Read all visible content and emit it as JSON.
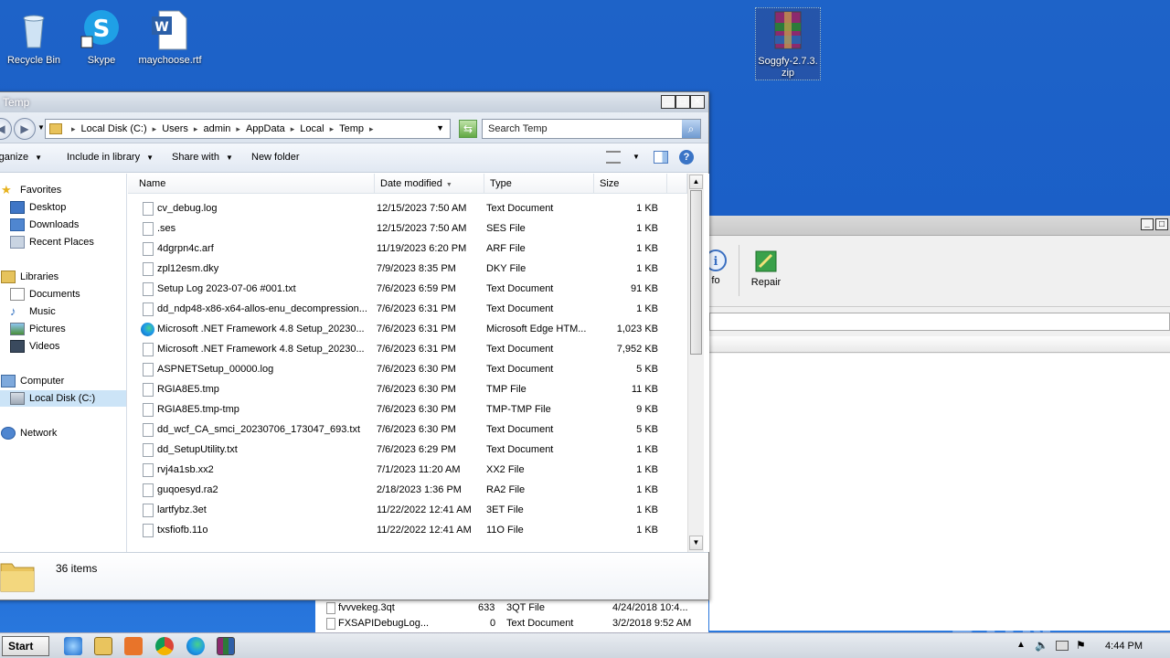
{
  "desktop": {
    "icons": [
      {
        "label": "Recycle Bin"
      },
      {
        "label": "Skype"
      },
      {
        "label": "maychoose.rtf"
      },
      {
        "label": "Soggfy-2.7.3.\nzip"
      }
    ]
  },
  "background_app": {
    "toolbar": {
      "info_label": "fo",
      "repair_label": "Repair"
    },
    "rows": [
      {
        "name": "fvvvekeg.3qt",
        "size": "633",
        "type": "3QT File",
        "modified": "4/24/2018 10:4..."
      },
      {
        "name": "FXSAPIDebugLog...",
        "size": "0",
        "type": "Text Document",
        "modified": "3/2/2018 9:52 AM"
      }
    ]
  },
  "explorer": {
    "title": "Temp",
    "address": [
      "Local Disk (C:)",
      "Users",
      "admin",
      "AppData",
      "Local",
      "Temp"
    ],
    "search_placeholder": "Search Temp",
    "commands": {
      "organize": "rganize",
      "include": "Include in library",
      "share": "Share with",
      "new_folder": "New folder"
    },
    "nav": {
      "favorites": "Favorites",
      "desktop": "Desktop",
      "downloads": "Downloads",
      "recent": "Recent Places",
      "libraries": "Libraries",
      "documents": "Documents",
      "music": "Music",
      "pictures": "Pictures",
      "videos": "Videos",
      "computer": "Computer",
      "local_disk": "Local Disk (C:)",
      "network": "Network"
    },
    "columns": {
      "name": "Name",
      "date": "Date modified",
      "type": "Type",
      "size": "Size"
    },
    "files": [
      {
        "name": "cv_debug.log",
        "date": "12/15/2023 7:50 AM",
        "type": "Text Document",
        "size": "1 KB",
        "icon": "file-icon"
      },
      {
        "name": ".ses",
        "date": "12/15/2023 7:50 AM",
        "type": "SES File",
        "size": "1 KB",
        "icon": "file-icon"
      },
      {
        "name": "4dgrpn4c.arf",
        "date": "11/19/2023 6:20 PM",
        "type": "ARF File",
        "size": "1 KB",
        "icon": "file-icon"
      },
      {
        "name": "zpl12esm.dky",
        "date": "7/9/2023 8:35 PM",
        "type": "DKY File",
        "size": "1 KB",
        "icon": "file-icon"
      },
      {
        "name": "Setup Log 2023-07-06 #001.txt",
        "date": "7/6/2023 6:59 PM",
        "type": "Text Document",
        "size": "91 KB",
        "icon": "file-icon"
      },
      {
        "name": "dd_ndp48-x86-x64-allos-enu_decompression...",
        "date": "7/6/2023 6:31 PM",
        "type": "Text Document",
        "size": "1 KB",
        "icon": "file-icon"
      },
      {
        "name": "Microsoft .NET Framework 4.8 Setup_20230...",
        "date": "7/6/2023 6:31 PM",
        "type": "Microsoft Edge HTM...",
        "size": "1,023 KB",
        "icon": "edge-icon"
      },
      {
        "name": "Microsoft .NET Framework 4.8 Setup_20230...",
        "date": "7/6/2023 6:31 PM",
        "type": "Text Document",
        "size": "7,952 KB",
        "icon": "file-icon"
      },
      {
        "name": "ASPNETSetup_00000.log",
        "date": "7/6/2023 6:30 PM",
        "type": "Text Document",
        "size": "5 KB",
        "icon": "file-icon"
      },
      {
        "name": "RGIA8E5.tmp",
        "date": "7/6/2023 6:30 PM",
        "type": "TMP File",
        "size": "11 KB",
        "icon": "file-icon"
      },
      {
        "name": "RGIA8E5.tmp-tmp",
        "date": "7/6/2023 6:30 PM",
        "type": "TMP-TMP File",
        "size": "9 KB",
        "icon": "file-icon"
      },
      {
        "name": "dd_wcf_CA_smci_20230706_173047_693.txt",
        "date": "7/6/2023 6:30 PM",
        "type": "Text Document",
        "size": "5 KB",
        "icon": "file-icon"
      },
      {
        "name": "dd_SetupUtility.txt",
        "date": "7/6/2023 6:29 PM",
        "type": "Text Document",
        "size": "1 KB",
        "icon": "file-icon"
      },
      {
        "name": "rvj4a1sb.xx2",
        "date": "7/1/2023 11:20 AM",
        "type": "XX2 File",
        "size": "1 KB",
        "icon": "file-icon"
      },
      {
        "name": "guqoesyd.ra2",
        "date": "2/18/2023 1:36 PM",
        "type": "RA2 File",
        "size": "1 KB",
        "icon": "file-icon"
      },
      {
        "name": "lartfybz.3et",
        "date": "11/22/2022 12:41 AM",
        "type": "3ET File",
        "size": "1 KB",
        "icon": "file-icon"
      },
      {
        "name": "txsfiofb.11o",
        "date": "11/22/2022 12:41 AM",
        "type": "11O File",
        "size": "1 KB",
        "icon": "file-icon"
      }
    ],
    "status": "36 items"
  },
  "taskbar": {
    "start": "Start",
    "clock": "4:44 PM"
  },
  "watermark": "ANY RUN"
}
